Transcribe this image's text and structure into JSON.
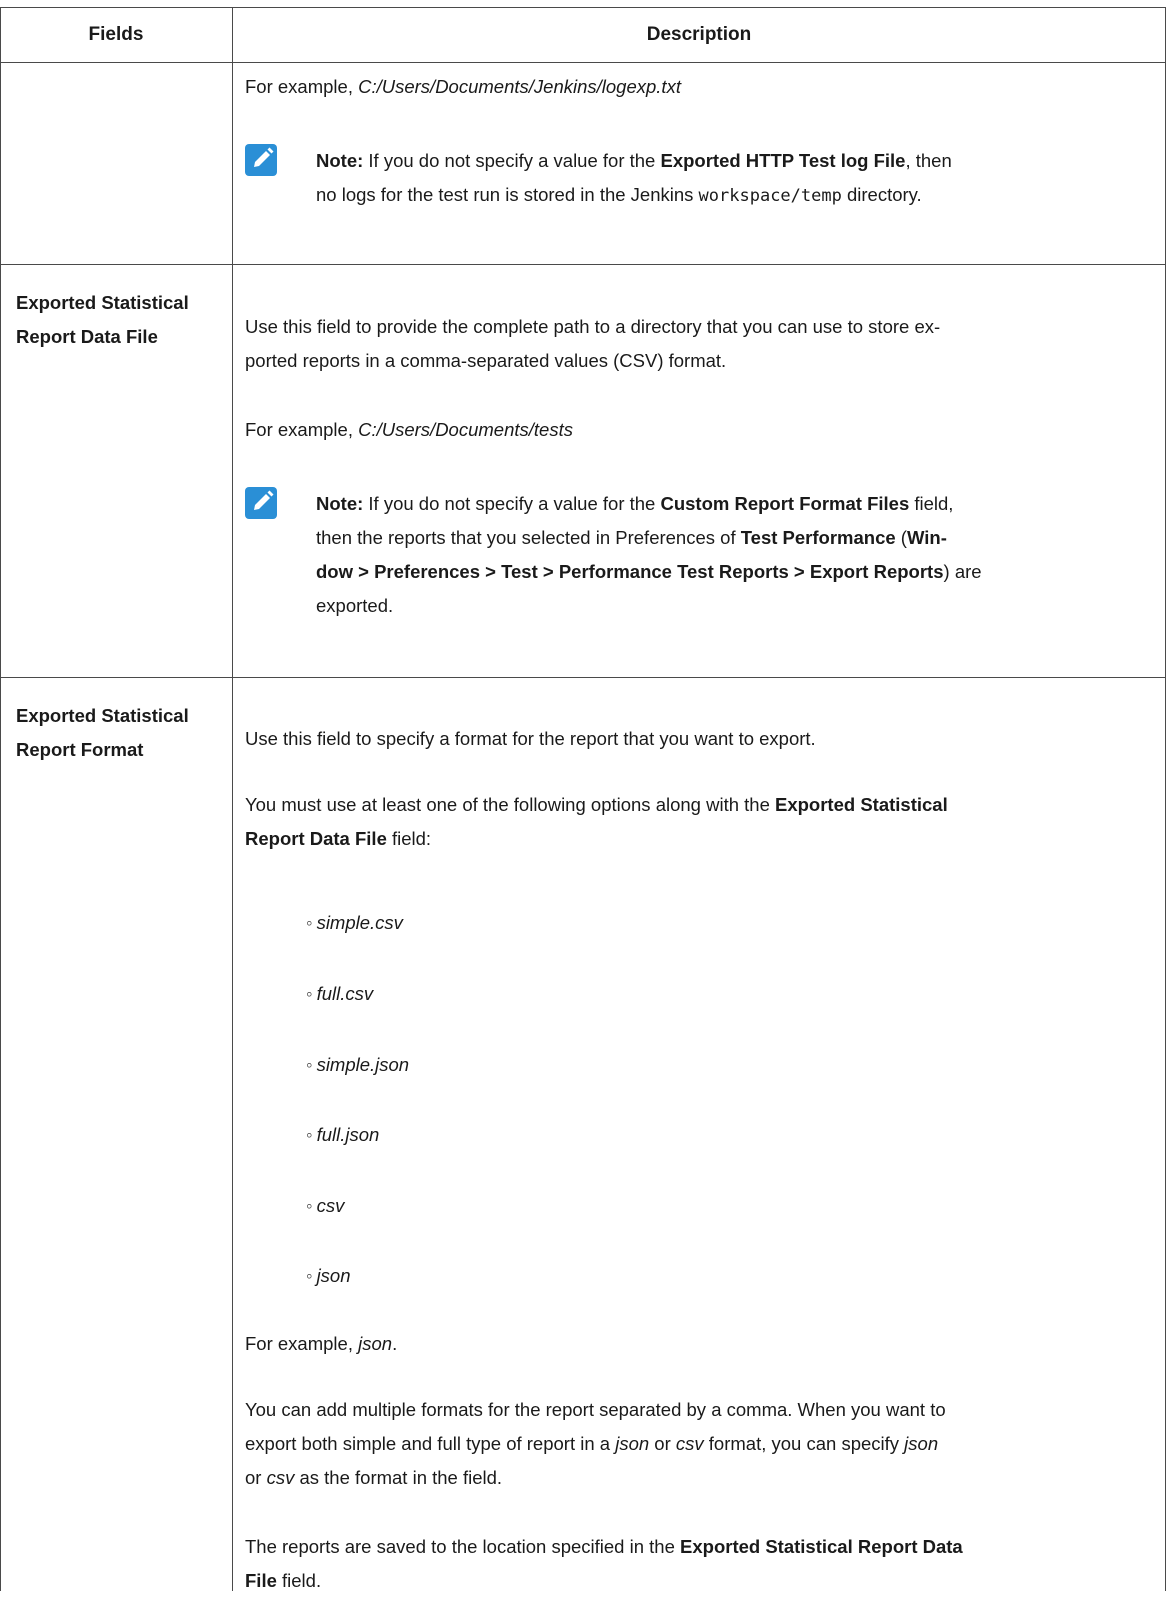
{
  "header": {
    "fields": "Fields",
    "description": "Description"
  },
  "row1": {
    "example_prefix": "For example, ",
    "example_value": "C:/Users/Documents/Jenkins/logexp.txt",
    "note_label": "Note:",
    "note_a": " If you do not specify a value for the ",
    "note_b": "Exported HTTP Test log File",
    "note_c": ", then",
    "note_d": "no logs for the test run is stored in the Jenkins ",
    "note_code": "workspace/temp",
    "note_e": " directory."
  },
  "row2": {
    "field_line1": "Exported Statistical",
    "field_line2": "Report Data File",
    "desc_line1": "Use this field to provide the complete path to a directory that you can use to store ex-",
    "desc_line2": "ported reports in a comma-separated values (CSV) format.",
    "example_prefix": "For example, ",
    "example_value": "C:/Users/Documents/tests",
    "note_label": "Note:",
    "note_a": " If you do not specify a value for the ",
    "note_b": "Custom Report Format Files",
    "note_c": " field,",
    "note_d": "then the reports that you selected in Preferences of ",
    "note_e": "Test Performance",
    "note_f": " (",
    "note_g": "Win-",
    "note_h": "dow > Preferences > Test > Performance Test Reports > Export Reports",
    "note_i": ") are",
    "note_j": "exported."
  },
  "row3": {
    "field_line1": "Exported Statistical",
    "field_line2": "Report Format",
    "desc1": "Use this field to specify a format for the report that you want to export.",
    "desc2_a": "You must use at least one of the following options along with the ",
    "desc2_b": "Exported Statistical",
    "desc2_c": "Report Data File",
    "desc2_d": " field:",
    "options": [
      "simple.csv",
      "full.csv",
      "simple.json",
      "full.json",
      "csv",
      "json"
    ],
    "bullet": "◦",
    "example_prefix": "For example, ",
    "example_value": "json",
    "example_suffix": ".",
    "multi_a": "You can add multiple formats for the report separated by a comma. When you want to",
    "multi_b": "export both simple and full type of report in a ",
    "multi_json1": "json",
    "multi_or": " or ",
    "multi_csv1": "csv",
    "multi_c": " format, you can specify ",
    "multi_json2": "json",
    "multi_d": "or ",
    "multi_csv2": "csv",
    "multi_e": " as the format in the field.",
    "saved_a": "The reports are saved to the location specified in the ",
    "saved_b": "Exported Statistical Report Data",
    "saved_c": "File",
    "saved_d": " field."
  },
  "colors": {
    "note_icon": "#2a8fd6",
    "border": "#4a4a4a"
  },
  "icons": {
    "note": "pencil-note-icon"
  }
}
